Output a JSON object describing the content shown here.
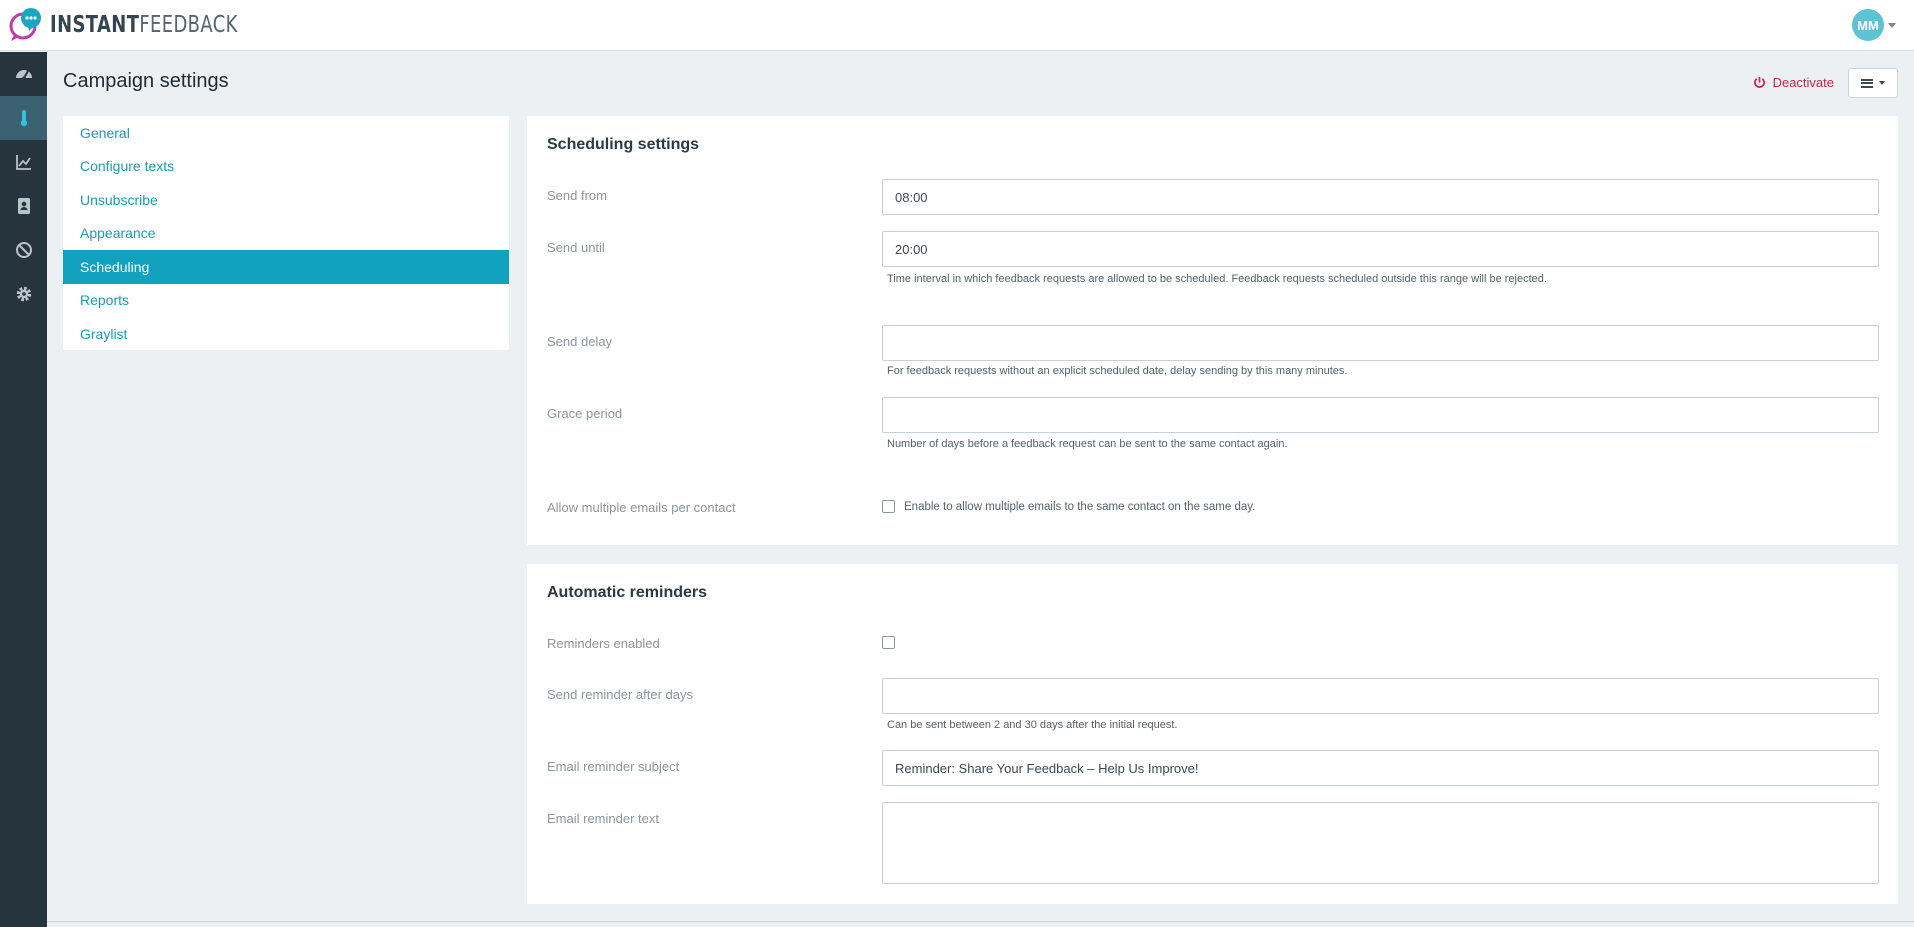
{
  "app": {
    "logo_bold": "INSTANT",
    "logo_light": "FEEDBACK",
    "user_initials": "MM"
  },
  "rail": {
    "items": [
      {
        "icon": "speedometer-icon"
      },
      {
        "icon": "thermometer-icon"
      },
      {
        "icon": "trend-chart-icon"
      },
      {
        "icon": "contacts-book-icon"
      },
      {
        "icon": "block-icon"
      },
      {
        "icon": "gear-icon"
      }
    ]
  },
  "page": {
    "title": "Campaign settings",
    "deactivate_label": "Deactivate"
  },
  "settings_nav": {
    "items": [
      {
        "label": "General",
        "active": false
      },
      {
        "label": "Configure texts",
        "active": false
      },
      {
        "label": "Unsubscribe",
        "active": false
      },
      {
        "label": "Appearance",
        "active": false
      },
      {
        "label": "Scheduling",
        "active": true
      },
      {
        "label": "Reports",
        "active": false
      },
      {
        "label": "Graylist",
        "active": false
      }
    ]
  },
  "scheduling": {
    "title": "Scheduling settings",
    "send_from": {
      "label": "Send from",
      "value": "08:00"
    },
    "send_until": {
      "label": "Send until",
      "value": "20:00",
      "help": "Time interval in which feedback requests are allowed to be scheduled. Feedback requests scheduled outside this range will be rejected."
    },
    "send_delay": {
      "label": "Send delay",
      "value": "",
      "help": "For feedback requests without an explicit scheduled date, delay sending by this many minutes."
    },
    "grace_period": {
      "label": "Grace period",
      "value": "",
      "help": "Number of days before a feedback request can be sent to the same contact again."
    },
    "multiple_emails": {
      "label": "Allow multiple emails per contact",
      "checked": false,
      "check_label": "Enable to allow multiple emails to the same contact on the same day."
    }
  },
  "reminders": {
    "title": "Automatic reminders",
    "enabled": {
      "label": "Reminders enabled",
      "checked": false
    },
    "after_days": {
      "label": "Send reminder after days",
      "value": "",
      "help": "Can be sent between 2 and 30 days after the initial request."
    },
    "subject": {
      "label": "Email reminder subject",
      "value": "Reminder: Share Your Feedback – Help Us Improve!"
    },
    "text": {
      "label": "Email reminder text",
      "value": ""
    }
  },
  "colors": {
    "accent": "#12a1be",
    "danger": "#c8264a",
    "rail": "#26343d",
    "rail_active": "#3b6170",
    "avatar": "#5cc2d4"
  }
}
